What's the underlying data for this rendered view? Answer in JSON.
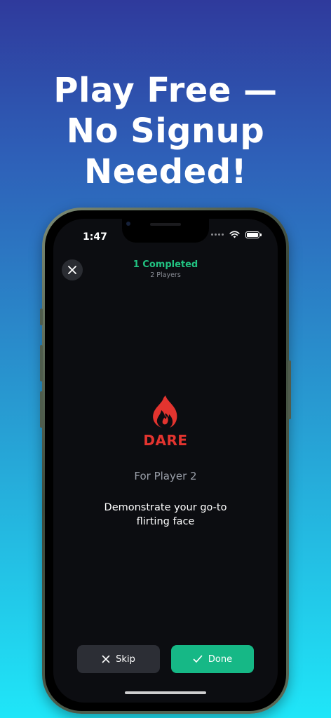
{
  "promo": {
    "headline_line1": "Play Free —",
    "headline_line2": "No Signup",
    "headline_line3": "Needed!"
  },
  "status_bar": {
    "time": "1:47"
  },
  "header": {
    "completed": "1 Completed",
    "players": "2 Players"
  },
  "card": {
    "type": "DARE",
    "player": "For Player 2",
    "text": "Demonstrate your go-to flirting face",
    "icon": "flame-icon",
    "accent": "#e3342f"
  },
  "actions": {
    "skip_label": "Skip",
    "done_label": "Done"
  },
  "colors": {
    "completed_green": "#21c281",
    "done_button": "#16b886",
    "skip_button": "#2c2e35"
  }
}
